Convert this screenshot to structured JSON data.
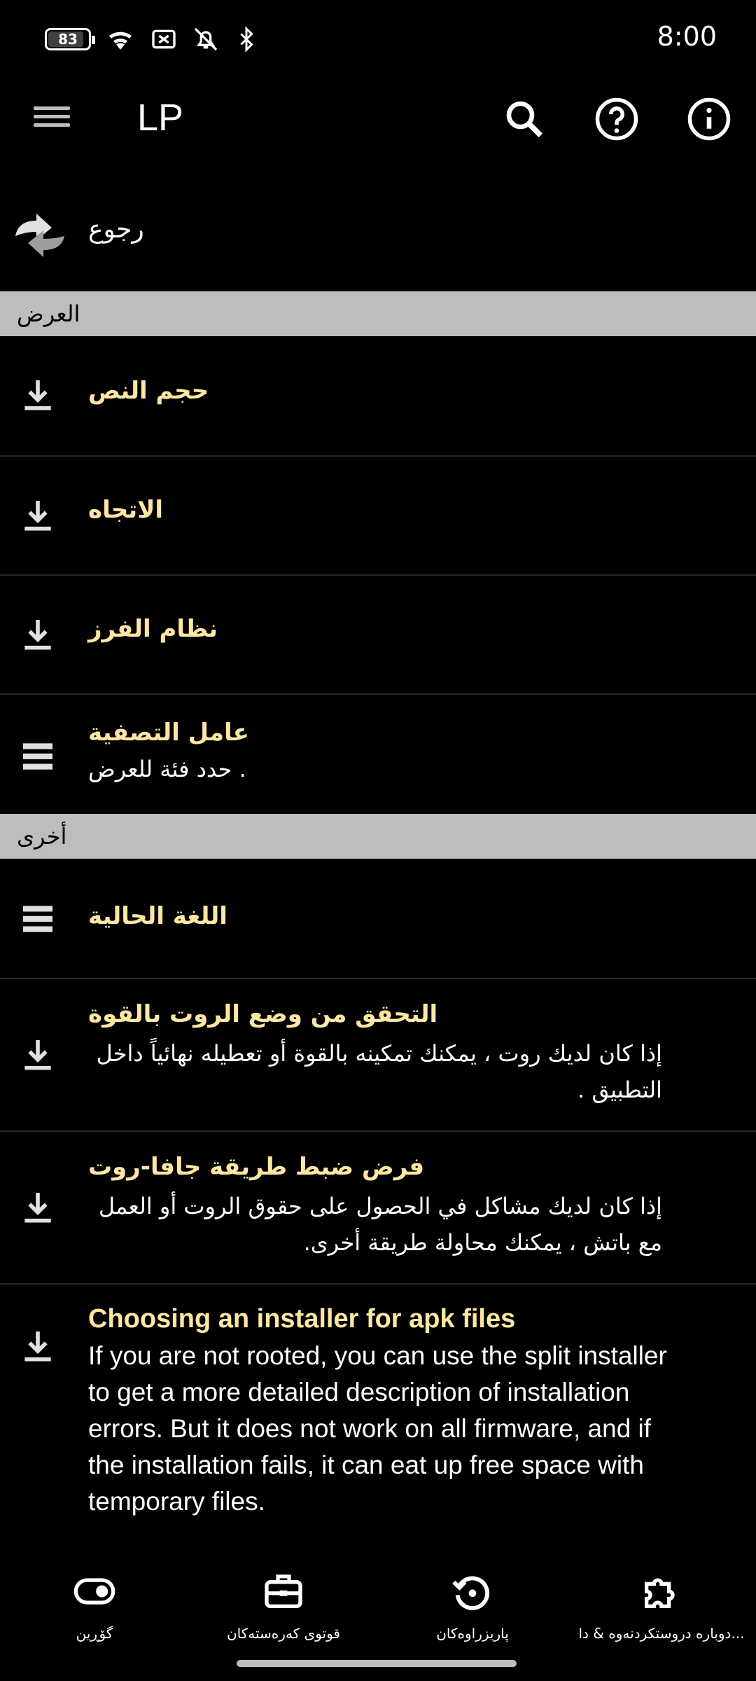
{
  "status_bar": {
    "battery": "83",
    "time": "8:00",
    "icons": [
      "battery-icon",
      "wifi-icon",
      "no-sim-icon",
      "notifications-off-icon",
      "bluetooth-icon"
    ]
  },
  "app_bar": {
    "title": "LP",
    "icons": [
      "menu-icon",
      "search-icon",
      "help-icon",
      "info-icon"
    ]
  },
  "back": {
    "label": "رجوع"
  },
  "sections": {
    "display": "العرض",
    "other": "أخرى"
  },
  "items": {
    "text_size": {
      "title": "حجم النص"
    },
    "orientation": {
      "title": "الاتجاه"
    },
    "sort_order": {
      "title": "نظام الفرز"
    },
    "filter": {
      "title": "عامل التصفية",
      "desc": "حدد فئة للعرض ."
    },
    "current_language": {
      "title": "اللغة الحالية"
    },
    "force_root": {
      "title": "التحقق من وضع الروت بالقوة",
      "desc": "إذا كان لديك روت ، يمكنك تمكينه بالقوة أو تعطيله نهائياً داخل التطبيق ."
    },
    "force_java_root": {
      "title": "فرض ضبط طريقة جافا-روت",
      "desc": "إذا كان لديك مشاكل في الحصول على حقوق الروت أو العمل مع باتش ، يمكنك محاولة طريقة أخرى."
    },
    "installer": {
      "title": "Choosing an installer for apk files",
      "desc": "If you are not rooted, you can use the split installer to get a more detailed description of installation errors. But it does not work on all firmware, and if the installation fails, it can eat up free space with temporary files."
    }
  },
  "bottom_nav": [
    {
      "label": "گۆڕین",
      "icon": "toggle-icon"
    },
    {
      "label": "قوتوی کەرەستەکان",
      "icon": "toolbox-icon"
    },
    {
      "label": "پاریزراوەکان",
      "icon": "restore-icon"
    },
    {
      "label": "دوباره دروستکردنه‌وه & دا...",
      "icon": "puzzle-icon"
    }
  ],
  "colors": {
    "background": "#000000",
    "section_header": "#bdbdbd",
    "item_title": "#ffe7a3"
  }
}
